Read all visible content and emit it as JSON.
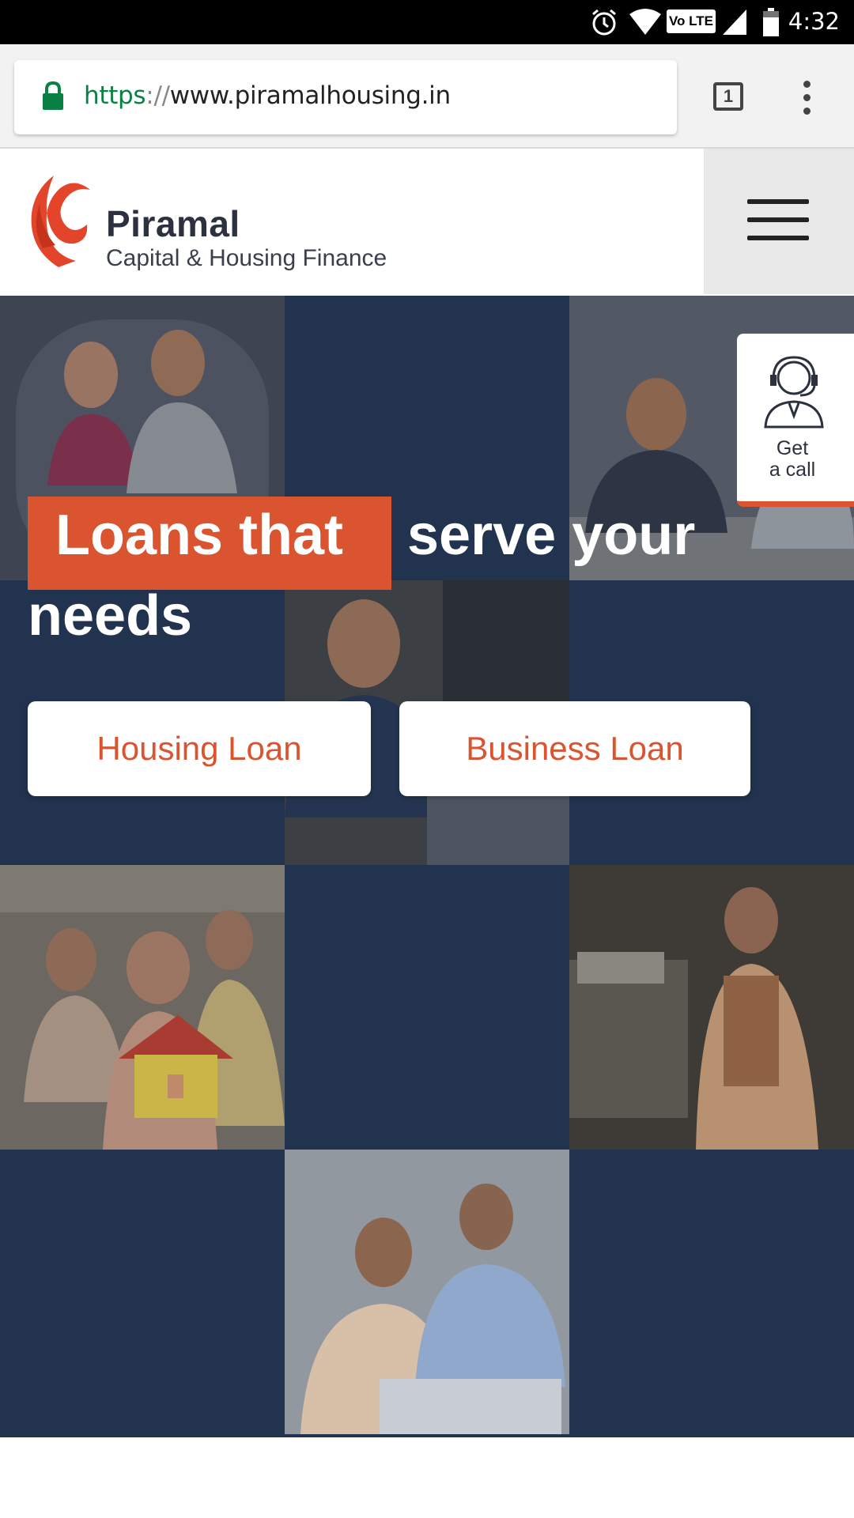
{
  "status_bar": {
    "time": "4:32",
    "icons": [
      "alarm-icon",
      "wifi-icon",
      "volte-icon",
      "signal-icon",
      "battery-icon"
    ],
    "volte_label": "Vo LTE"
  },
  "browser": {
    "url_scheme": "https",
    "url_separator": "://",
    "url_host": "www.piramalhousing.in",
    "tab_count": "1"
  },
  "header": {
    "brand_name": "Piramal",
    "brand_tagline": "Capital & Housing Finance"
  },
  "hero": {
    "headline_highlight": "Loans that",
    "headline_rest_1": "serve your",
    "headline_rest_2": "needs",
    "buttons": {
      "housing": "Housing Loan",
      "business": "Business Loan"
    },
    "get_call": {
      "line1": "Get",
      "line2": "a call"
    }
  },
  "colors": {
    "brand_orange": "#d9542f",
    "hero_navy": "#22334f",
    "url_green": "#0b8043"
  }
}
